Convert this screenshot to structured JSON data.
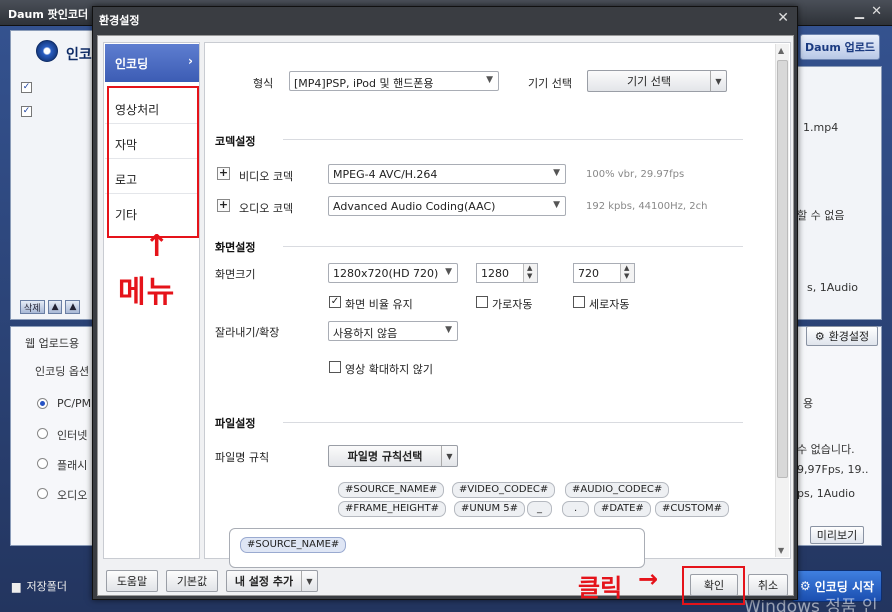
{
  "background": {
    "app_title": "Daum 팟인코더",
    "app_title_chevron": "▾",
    "minimize": "▁",
    "close": "✕",
    "encoder_tab": "인코",
    "daum_upload_button": "Daum 업로드",
    "left_labels": {
      "delete": "삭제",
      "web_upload": "웹 업로드용",
      "encoding_options": "인코딩 옵션",
      "radio_1": "PC/PM",
      "radio_2": "인터넷",
      "radio_3": "플래시",
      "radio_4": "오디오",
      "save_folder": "저장폴더"
    },
    "right_labels": {
      "file_ext": "1.mp4",
      "cannot": "할 수 없음",
      "audio_info": "s, 1Audio",
      "settings_button": "환경설정",
      "use": "용",
      "cannot2": "수 없습니다.",
      "fps": "9,97Fps, 19..",
      "audio_info2": "ps, 1Audio",
      "preview_button": "미리보기",
      "start_button": "인코딩 시작"
    },
    "watermark": "Windows 정품 인"
  },
  "dialog": {
    "title": "환경설정",
    "close_symbol": "✕",
    "menu": {
      "active": "인코딩",
      "active_arrow": "›",
      "items": [
        "영상처리",
        "자막",
        "로고",
        "기타"
      ]
    },
    "annotations": {
      "menu_arrow": "↑",
      "menu_label": "메뉴",
      "click_label": "클릭",
      "click_arrow": "→"
    },
    "format": {
      "label": "형식",
      "value": "[MP4]PSP, iPod 및 핸드폰용",
      "device_label": "기기 선택",
      "device_button": "기기 선택"
    },
    "codec": {
      "section": "코덱설정",
      "video_label": "비디오 코덱",
      "video_value": "MPEG-4 AVC/H.264",
      "video_info": "100% vbr, 29.97fps",
      "audio_label": "오디오 코덱",
      "audio_value": "Advanced Audio Coding(AAC)",
      "audio_info": "192 kpbs, 44100Hz, 2ch"
    },
    "screen": {
      "section": "화면설정",
      "size_label": "화면크기",
      "size_value": "1280x720(HD 720)",
      "width": "1280",
      "height": "720",
      "keep_ratio": "화면 비율 유지",
      "keep_ratio_checked": true,
      "flip_h": "가로자동",
      "flip_v": "세로자동",
      "crop_label": "잘라내기/확장",
      "crop_value": "사용하지 않음",
      "no_enlarge": "영상 확대하지 않기"
    },
    "file": {
      "section": "파일설정",
      "rule_label": "파일명 규칙",
      "rule_button": "파일명 규칙선택",
      "tags_row1": [
        "#SOURCE_NAME#",
        "#VIDEO_CODEC#",
        "#AUDIO_CODEC#"
      ],
      "tags_row2": [
        "#FRAME_HEIGHT#",
        "#UNUM 5#",
        "_",
        ".",
        "#DATE#",
        "#CUSTOM#"
      ],
      "pattern_value": "#SOURCE_NAME#"
    },
    "buttons": {
      "help": "도움말",
      "default": "기본값",
      "add_setting": "내 설정 추가",
      "ok": "확인",
      "cancel": "취소"
    }
  }
}
